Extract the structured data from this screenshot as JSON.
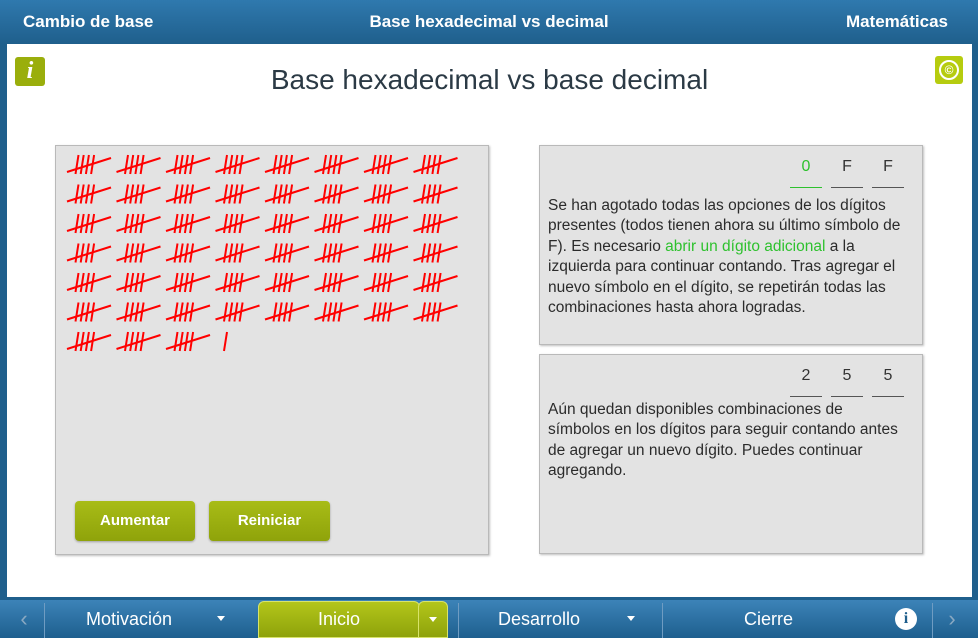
{
  "header": {
    "left_title": "Cambio de base",
    "center_title": "Base hexadecimal vs decimal",
    "right_title": "Matemáticas"
  },
  "page": {
    "title": "Base hexadecimal vs base decimal",
    "info_icon": "i",
    "copyright_icon": "©"
  },
  "tally": {
    "count": 256,
    "group_size": 5,
    "groups_per_row": 8,
    "color": "#ff0000"
  },
  "buttons": {
    "increase": "Aumentar",
    "reset": "Reiniciar"
  },
  "hex": {
    "digits": [
      "0",
      "F",
      "F"
    ],
    "text_before": "Se han agotado todas las opciones de los dígitos presentes (todos tienen ahora su último símbolo de F). Es necesario ",
    "highlight": "abrir un dígito adicional",
    "text_after": " a la izquierda para continuar contando. Tras agregar el nuevo símbolo en el dígito, se repetirán todas las combinaciones hasta ahora logradas.",
    "highlight_color": "#2ec12e"
  },
  "decimal": {
    "digits": [
      "2",
      "5",
      "5"
    ],
    "text": "Aún quedan disponibles combinaciones de símbolos en los dígitos para seguir contando antes de agregar un nuevo dígito. Puedes continuar agregando."
  },
  "nav": {
    "motivation": "Motivación",
    "start": "Inicio",
    "development": "Desarrollo",
    "closing": "Cierre",
    "info": "i",
    "prev": "‹",
    "next": "›"
  }
}
